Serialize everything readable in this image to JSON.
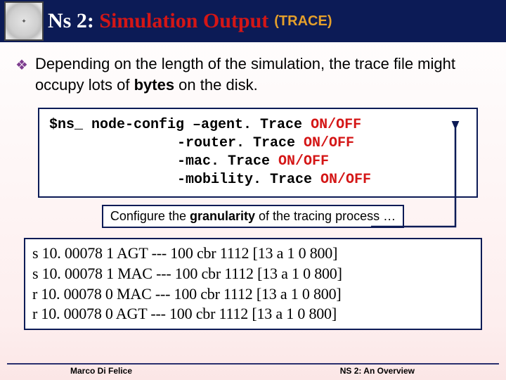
{
  "header": {
    "title_plain": "Ns 2: ",
    "title_red": "Simulation Output",
    "suffix": "(TRACE)"
  },
  "bullet": {
    "pre": "Depending on the length of the simulation, the trace file might occupy lots of ",
    "bold": "bytes",
    "post": " on the disk."
  },
  "code": {
    "line1_pre": "$ns_ node-config –agent. Trace ",
    "line1_kw": "ON/OFF",
    "line2_pre": "-router. Trace ",
    "line2_kw": "ON/OFF",
    "line3_pre": "-mac. Trace ",
    "line3_kw": "ON/OFF",
    "line4_pre": "-mobility. Trace ",
    "line4_kw": "ON/OFF"
  },
  "granularity": {
    "pre": "Configure the ",
    "bold": "granularity",
    "post": " of the tracing process …"
  },
  "trace": {
    "l1": "s 10. 00078 1 AGT --- 100 cbr 1112 [13 a 1 0 800]",
    "l2": "s 10. 00078 1 MAC --- 100 cbr 1112 [13 a 1 0 800]",
    "l3": "r 10. 00078 0 MAC --- 100 cbr 1112 [13 a 1 0 800]",
    "l4": "r 10. 00078 0 AGT --- 100 cbr 1112 [13 a 1 0 800]"
  },
  "footer": {
    "left": "Marco Di Felice",
    "right": "NS 2: An Overview"
  }
}
